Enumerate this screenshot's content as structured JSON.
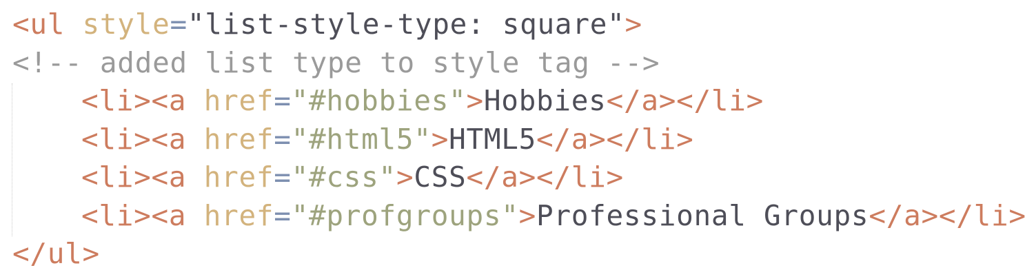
{
  "code": {
    "line1": {
      "open": "<ul",
      "attr": " style",
      "eq": "=",
      "q1": "\"",
      "value": "list-style-type: square",
      "q2": "\"",
      "close": ">"
    },
    "comment": "<!-- added list type to style tag -->",
    "items": [
      {
        "open": "<li><a",
        "attr": " href",
        "eq": "=",
        "value": "\"#hobbies\"",
        "close": ">",
        "text": "Hobbies",
        "end": "</a></li>"
      },
      {
        "open": "<li><a",
        "attr": " href",
        "eq": "=",
        "value": "\"#html5\"",
        "close": ">",
        "text": "HTML5",
        "end": "</a></li>"
      },
      {
        "open": "<li><a",
        "attr": " href",
        "eq": "=",
        "value": "\"#css\"",
        "close": ">",
        "text": "CSS",
        "end": "</a></li>"
      },
      {
        "open": "<li><a",
        "attr": " href",
        "eq": "=",
        "value": "\"#profgroups\"",
        "close": ">",
        "text": "Professional Groups",
        "end": "</a></li>"
      }
    ],
    "closing": "</ul>"
  },
  "colors": {
    "tag": "#cd7c5e",
    "attribute": "#d3b37d",
    "equals": "#7d8fb0",
    "string": "#9da37d",
    "text": "#4e4e58",
    "comment": "#9a9a9a"
  }
}
